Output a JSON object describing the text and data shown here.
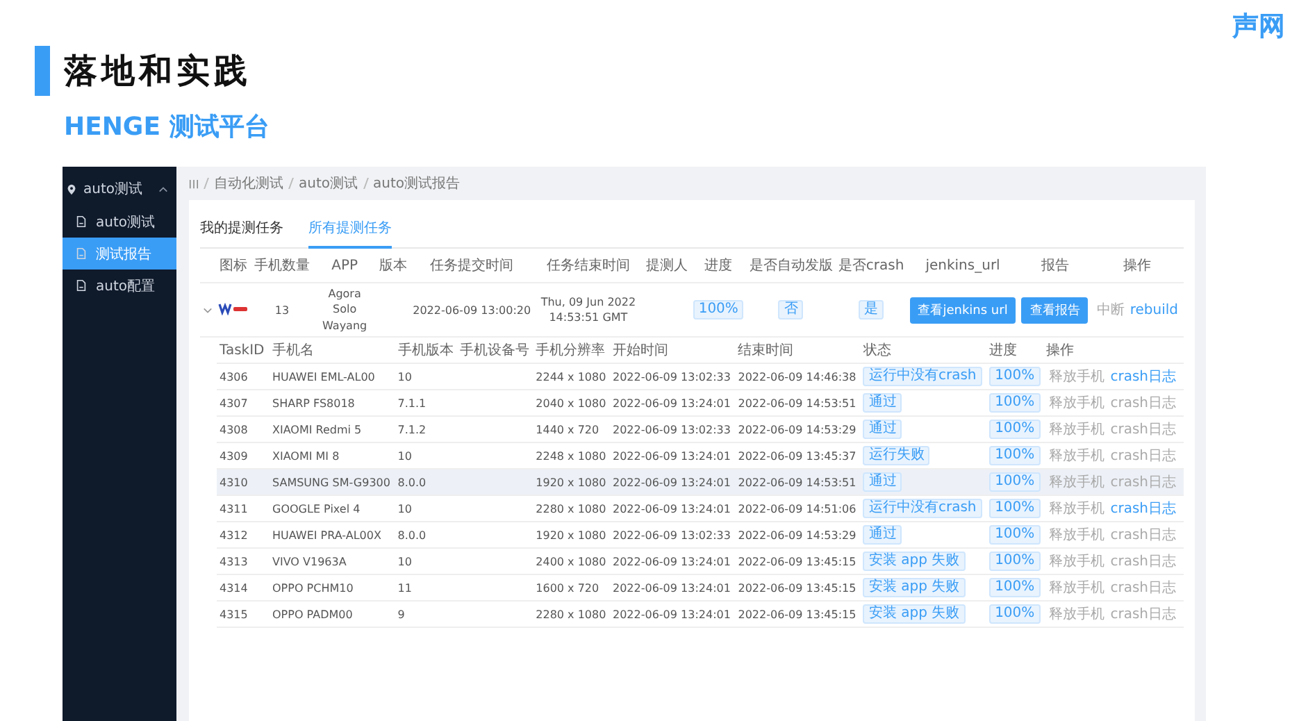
{
  "slide": {
    "title": "落地和实践",
    "subtitle": "HENGE 测试平台",
    "logo": "声网"
  },
  "sidebar": {
    "group": {
      "label": "auto测试",
      "expanded": true
    },
    "items": [
      {
        "label": "auto测试",
        "selected": false
      },
      {
        "label": "测试报告",
        "selected": true
      },
      {
        "label": "auto配置",
        "selected": false
      }
    ]
  },
  "breadcrumb": [
    "自动化测试",
    "auto测试",
    "auto测试报告"
  ],
  "tabs": [
    {
      "label": "我的提测任务",
      "selected": false
    },
    {
      "label": "所有提测任务",
      "selected": true
    }
  ],
  "task_table": {
    "columns": [
      "图标",
      "手机数量",
      "APP",
      "版本",
      "任务提交时间",
      "任务结束时间",
      "提测人",
      "进度",
      "是否自动发版",
      "是否crash",
      "jenkins_url",
      "报告",
      "操作"
    ],
    "rows": [
      {
        "expanded": true,
        "phone_count": "13",
        "app": "Agora Solo Wayang",
        "submitted": "2022-06-09 13:00:20",
        "finished": "Thu, 09 Jun 2022 14:53:51 GMT",
        "progress": "100%",
        "auto_release": "否",
        "crash": "是",
        "jenkins_button": "查看jenkins url",
        "report_button": "查看报告",
        "actions": [
          {
            "label": "中断",
            "disabled": true
          },
          {
            "label": "rebuild",
            "disabled": false
          }
        ]
      }
    ]
  },
  "phone_table": {
    "columns": [
      "TaskID",
      "手机名",
      "手机版本",
      "手机设备号",
      "手机分辨率",
      "开始时间",
      "结束时间",
      "状态",
      "进度",
      "操作"
    ],
    "rows": [
      {
        "task_id": "4306",
        "phone": "HUAWEI EML-AL00",
        "os": "10",
        "resolution": "2244 x 1080",
        "start": "2022-06-09 13:02:33",
        "end": "2022-06-09 14:46:38",
        "status": "运行中没有crash",
        "progress": "100%",
        "highlighted": false,
        "actions": [
          {
            "label": "释放手机",
            "disabled": true
          },
          {
            "label": "crash日志",
            "disabled": false
          }
        ]
      },
      {
        "task_id": "4307",
        "phone": "SHARP FS8018",
        "os": "7.1.1",
        "resolution": "2040 x 1080",
        "start": "2022-06-09 13:24:01",
        "end": "2022-06-09 14:53:51",
        "status": "通过",
        "progress": "100%",
        "highlighted": false,
        "actions": [
          {
            "label": "释放手机",
            "disabled": true
          },
          {
            "label": "crash日志",
            "disabled": true
          }
        ]
      },
      {
        "task_id": "4308",
        "phone": "XIAOMI Redmi 5",
        "os": "7.1.2",
        "resolution": "1440 x 720",
        "start": "2022-06-09 13:02:33",
        "end": "2022-06-09 14:53:29",
        "status": "通过",
        "progress": "100%",
        "highlighted": false,
        "actions": [
          {
            "label": "释放手机",
            "disabled": true
          },
          {
            "label": "crash日志",
            "disabled": true
          }
        ]
      },
      {
        "task_id": "4309",
        "phone": "XIAOMI MI 8",
        "os": "10",
        "resolution": "2248 x 1080",
        "start": "2022-06-09 13:24:01",
        "end": "2022-06-09 13:45:37",
        "status": "运行失败",
        "progress": "100%",
        "highlighted": false,
        "actions": [
          {
            "label": "释放手机",
            "disabled": true
          },
          {
            "label": "crash日志",
            "disabled": true
          }
        ]
      },
      {
        "task_id": "4310",
        "phone": "SAMSUNG SM-G9300",
        "os": "8.0.0",
        "resolution": "1920 x 1080",
        "start": "2022-06-09 13:24:01",
        "end": "2022-06-09 14:53:51",
        "status": "通过",
        "progress": "100%",
        "highlighted": true,
        "actions": [
          {
            "label": "释放手机",
            "disabled": true
          },
          {
            "label": "crash日志",
            "disabled": true
          }
        ]
      },
      {
        "task_id": "4311",
        "phone": "GOOGLE Pixel 4",
        "os": "10",
        "resolution": "2280 x 1080",
        "start": "2022-06-09 13:24:01",
        "end": "2022-06-09 14:51:06",
        "status": "运行中没有crash",
        "progress": "100%",
        "highlighted": false,
        "actions": [
          {
            "label": "释放手机",
            "disabled": true
          },
          {
            "label": "crash日志",
            "disabled": false
          }
        ]
      },
      {
        "task_id": "4312",
        "phone": "HUAWEI PRA-AL00X",
        "os": "8.0.0",
        "resolution": "1920 x 1080",
        "start": "2022-06-09 13:02:33",
        "end": "2022-06-09 14:53:29",
        "status": "通过",
        "progress": "100%",
        "highlighted": false,
        "actions": [
          {
            "label": "释放手机",
            "disabled": true
          },
          {
            "label": "crash日志",
            "disabled": true
          }
        ]
      },
      {
        "task_id": "4313",
        "phone": "VIVO V1963A",
        "os": "10",
        "resolution": "2400 x 1080",
        "start": "2022-06-09 13:24:01",
        "end": "2022-06-09 13:45:15",
        "status": "安装 app 失败",
        "progress": "100%",
        "highlighted": false,
        "actions": [
          {
            "label": "释放手机",
            "disabled": true
          },
          {
            "label": "crash日志",
            "disabled": true
          }
        ]
      },
      {
        "task_id": "4314",
        "phone": "OPPO PCHM10",
        "os": "11",
        "resolution": "1600 x 720",
        "start": "2022-06-09 13:24:01",
        "end": "2022-06-09 13:45:15",
        "status": "安装 app 失败",
        "progress": "100%",
        "highlighted": false,
        "actions": [
          {
            "label": "释放手机",
            "disabled": true
          },
          {
            "label": "crash日志",
            "disabled": true
          }
        ]
      },
      {
        "task_id": "4315",
        "phone": "OPPO PADM00",
        "os": "9",
        "resolution": "2280 x 1080",
        "start": "2022-06-09 13:24:01",
        "end": "2022-06-09 13:45:15",
        "status": "安装 app 失败",
        "progress": "100%",
        "highlighted": false,
        "actions": [
          {
            "label": "释放手机",
            "disabled": true
          },
          {
            "label": "crash日志",
            "disabled": true
          }
        ]
      }
    ]
  }
}
